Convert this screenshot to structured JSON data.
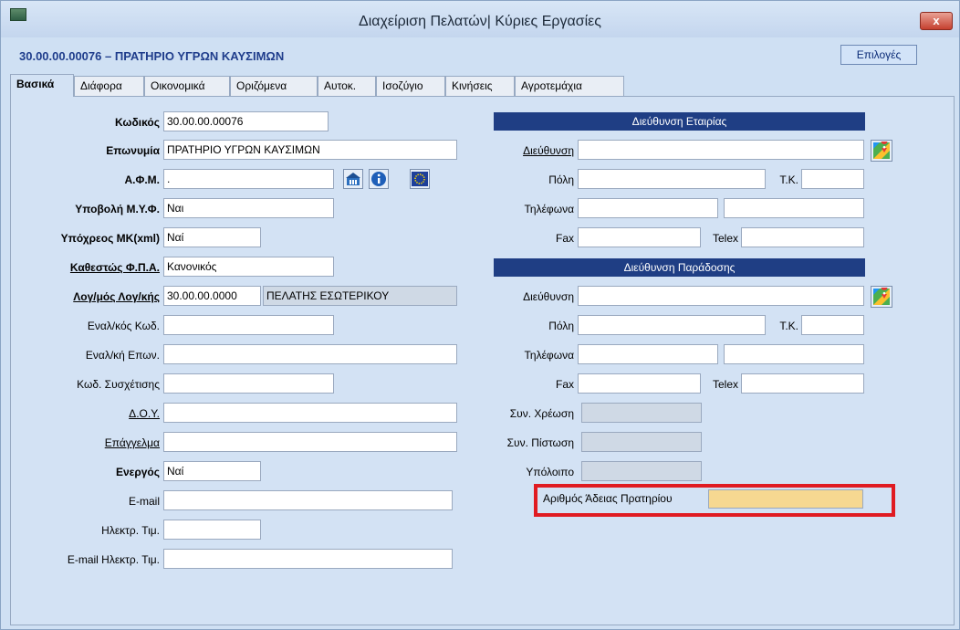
{
  "window": {
    "title": "Διαχείριση Πελατών| Κύριες Εργασίες",
    "close_symbol": "x"
  },
  "header": {
    "record": "30.00.00.00076 – ΠΡΑΤΗΡΙΟ ΥΓΡΩΝ ΚΑΥΣΙΜΩΝ",
    "options_label": "Επιλογές"
  },
  "tabs": [
    "Βασικά",
    "Διάφορα",
    "Οικονομικά",
    "Οριζόμενα",
    "Αυτοκ.",
    "Ισοζύγιο",
    "Κινήσεις",
    "Αγροτεμάχια"
  ],
  "left": {
    "code_label": "Κωδικός",
    "code_value": "30.00.00.00076",
    "name_label": "Επωνυμία",
    "name_value": "ΠΡΑΤΗΡΙΟ ΥΓΡΩΝ ΚΑΥΣΙΜΩΝ",
    "afm_label": "Α.Φ.Μ.",
    "afm_value": ".",
    "myf_label": "Υποβολή Μ.Υ.Φ.",
    "myf_value": "Ναι",
    "mk_label": "Υπόχρεος ΜΚ(xml)",
    "mk_value": "Ναί",
    "vat_label": "Καθεστώς Φ.Π.Α.",
    "vat_value": "Κανονικός",
    "account_label": "Λογ/μός Λογ/κής",
    "account_code": "30.00.00.0000",
    "account_name": "ΠΕΛΑΤΗΣ ΕΣΩΤΕΡΙΚΟΥ",
    "alt_code_label": "Εναλ/κός Κωδ.",
    "alt_name_label": "Εναλ/κή Επων.",
    "relation_label": "Κωδ. Συσχέτισης",
    "doy_label": "Δ.Ο.Υ.",
    "profession_label": "Επάγγελμα",
    "active_label": "Ενεργός",
    "active_value": "Ναί",
    "email_label": "E-mail",
    "einvoice_label": "Ηλεκτρ. Τιμ.",
    "einvoice_email_label": "E-mail Ηλεκτρ. Τιμ."
  },
  "right": {
    "company_section": "Διεύθυνση Εταιρίας",
    "delivery_section": "Διεύθυνση Παράδοσης",
    "address_label": "Διεύθυνση",
    "city_label": "Πόλη",
    "zip_label": "Τ.Κ.",
    "phones_label": "Τηλέφωνα",
    "fax_label": "Fax",
    "telex_label": "Telex",
    "debit_label": "Συν. Χρέωση",
    "credit_label": "Συν. Πίστωση",
    "balance_label": "Υπόλοιπο",
    "license_label": "Αριθμός Άδειας Πρατηρίου"
  },
  "colors": {
    "section_bar": "#1f3e84",
    "highlight_box": "#e01b22",
    "license_field": "#f6d891"
  }
}
